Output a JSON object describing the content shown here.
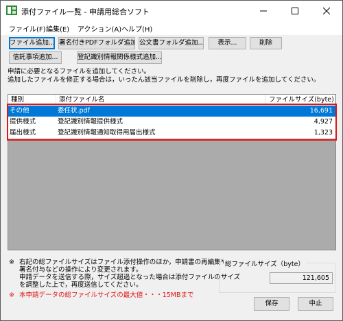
{
  "window": {
    "title": "添付ファイル一覧 - 申請用総合ソフト",
    "controls": {
      "minimize": "minimize-icon",
      "maximize": "maximize-icon",
      "close": "close-icon"
    }
  },
  "menu": [
    "ファイル(F)",
    "編集(E)",
    "アクション(A)",
    "ヘルプ(H)"
  ],
  "toolbar": {
    "row1": [
      "ファイル追加...",
      "署名付きPDFフォルダ追加...",
      "公文書フォルダ追加...",
      "表示...",
      "削除"
    ],
    "row2": [
      "信託事項追加...",
      "登記識別情報関係様式追加..."
    ]
  },
  "instructions": [
    "申請に必要となるファイルを追加してください。",
    "追加したファイルを修正する場合は，いったん該当ファイルを削除し，再度ファイルを追加してください。"
  ],
  "table": {
    "headers": [
      "種別",
      "添付ファイル名",
      "ファイルサイズ(byte)"
    ],
    "rows": [
      {
        "type": "その他",
        "name": "委任状.pdf",
        "size": "16,691",
        "selected": true
      },
      {
        "type": "提供様式",
        "name": "登記識別情報提供様式",
        "size": "4,927",
        "selected": false
      },
      {
        "type": "届出様式",
        "name": "登記識別情報通知取得用届出様式",
        "size": "1,323",
        "selected": false
      }
    ]
  },
  "notes": {
    "mark": "※",
    "lines": [
      "右記の総ファイルサイズはファイル添付操作のほか，申請書の再編集や",
      "署名付与などの操作により変更されます。",
      "申請データを送信する際，サイズ超過となった場合は添付ファイルのサイズ",
      "を調整した上で，再度送信してください。"
    ],
    "warning": "本申請データの総ファイルサイズの最大値・・・15MBまで"
  },
  "total": {
    "label": "総ファイルサイズ（byte）",
    "value": "121,605"
  },
  "actions": {
    "save": "保存",
    "cancel": "中止"
  },
  "colors": {
    "selection": "#0078d7",
    "highlight_border": "#e01414",
    "warning_text": "#e01414"
  }
}
